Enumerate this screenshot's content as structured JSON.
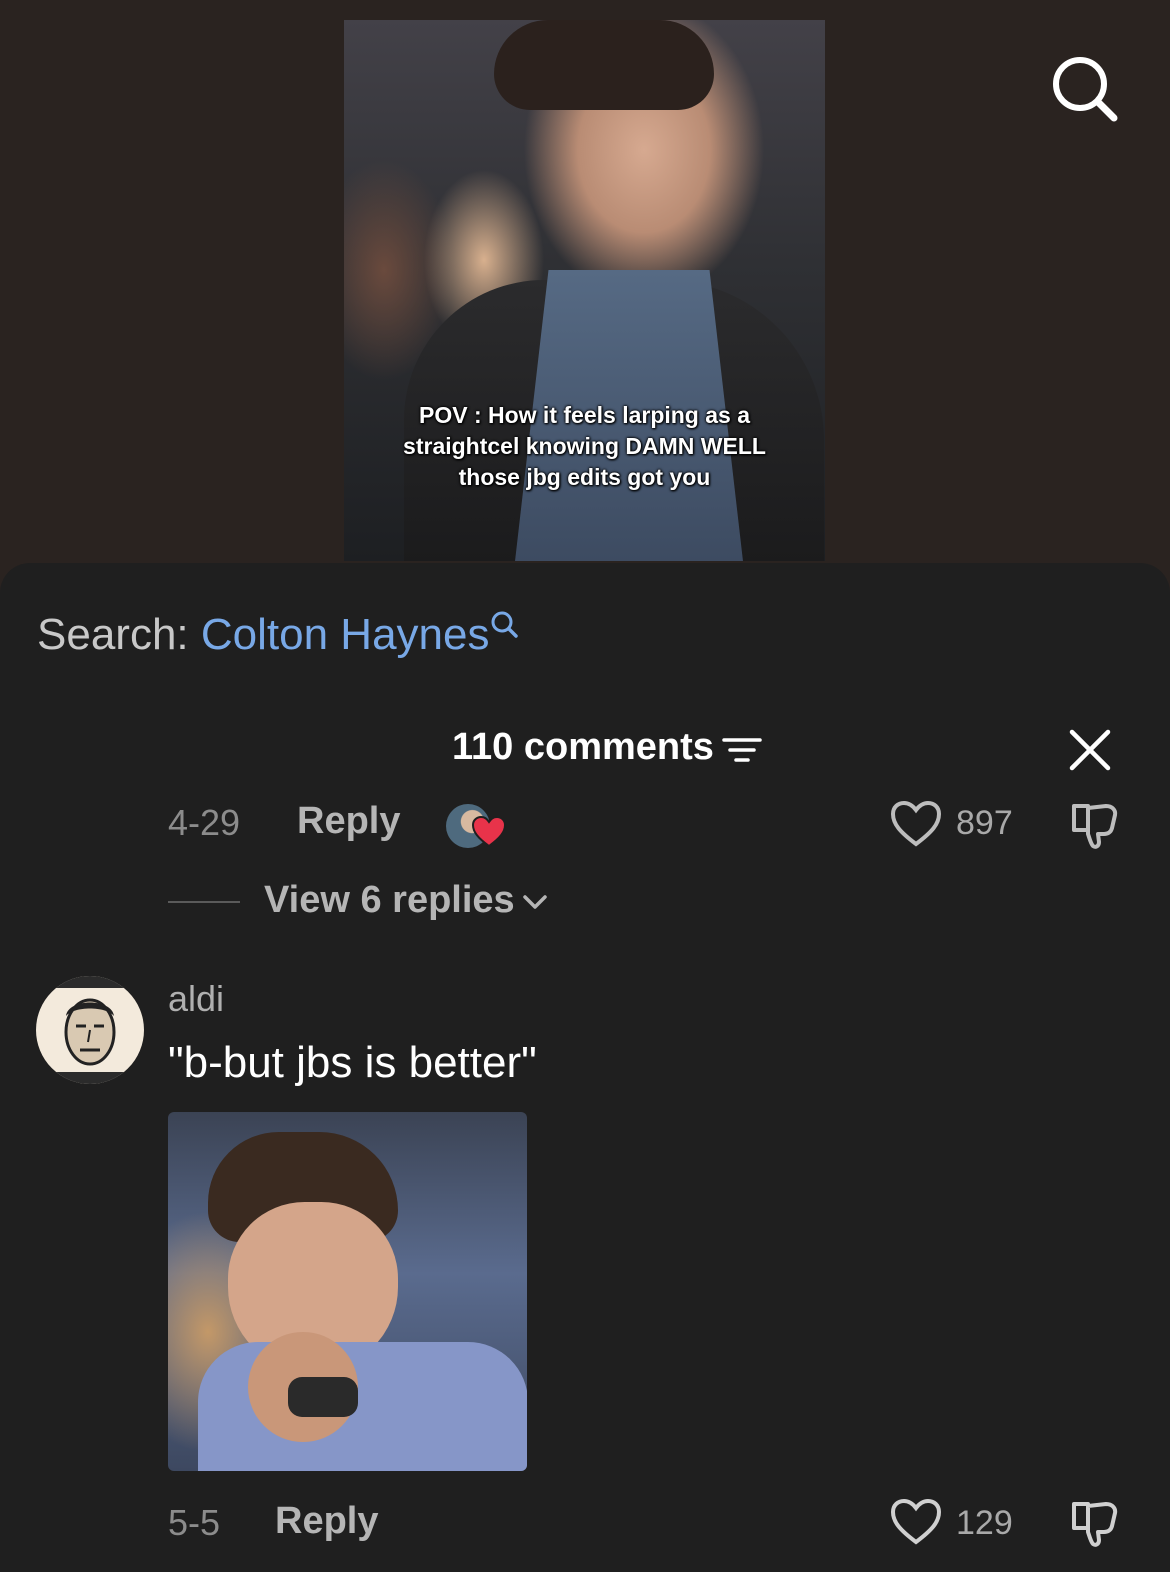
{
  "video": {
    "caption_line1": "POV : How it feels larping as a",
    "caption_line2": "straightcel knowing DAMN WELL",
    "caption_line3": "those jbg edits got you"
  },
  "search_bar": {
    "label": "Search:",
    "term": "Colton Haynes"
  },
  "comments_header": {
    "title": "110 comments"
  },
  "comment1": {
    "date": "4-29",
    "reply_label": "Reply",
    "likes": "897",
    "view_replies": "View 6 replies"
  },
  "comment2": {
    "username": "aldi",
    "text": "\"b-but jbs is better\"",
    "date": "5-5",
    "reply_label": "Reply",
    "likes": "129"
  },
  "colors": {
    "background": "#1f1f1f",
    "accent_link": "#78a8e6",
    "liked_heart": "#e8334a"
  }
}
